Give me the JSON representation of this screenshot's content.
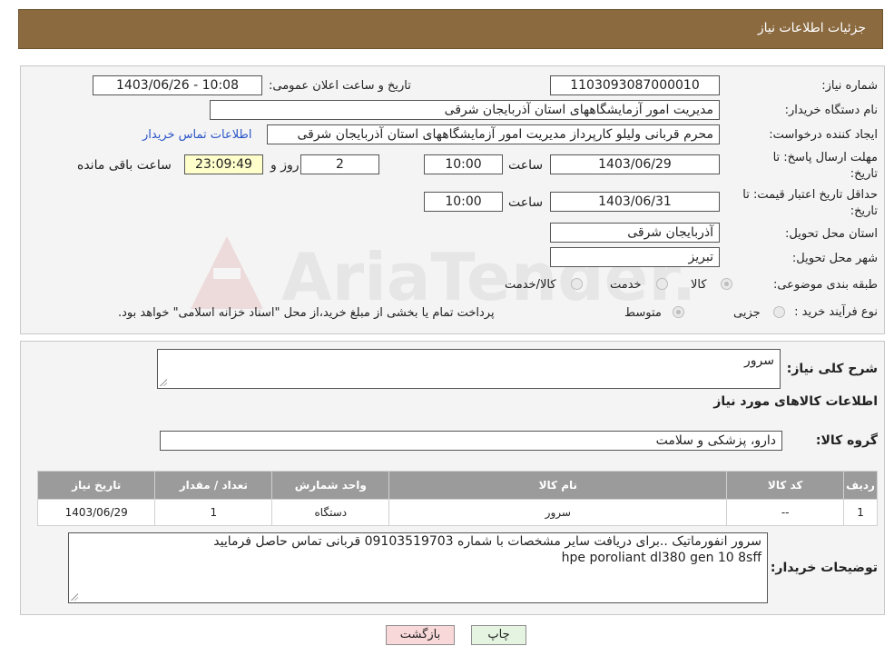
{
  "header": {
    "title": "جزئیات اطلاعات نیاز"
  },
  "watermark": {
    "text": "AriaTender.neT"
  },
  "form": {
    "need_number_label": "شماره نیاز:",
    "need_number": "1103093087000010",
    "announce_label": "تاریخ و ساعت اعلان عمومی:",
    "announce_value": "1403/06/26 - 10:08",
    "buyer_org_label": "نام دستگاه خریدار:",
    "buyer_org": "مدیریت امور آزمایشگاههای استان آذربایجان شرقی",
    "requester_label": "ایجاد کننده درخواست:",
    "requester": "محرم قربانی ولیلو کارپرداز مدیریت امور آزمایشگاههای استان آذربایجان شرقی",
    "contact_link": "اطلاعات تماس خریدار",
    "deadline_label_1": "مهلت ارسال پاسخ: تا",
    "deadline_label_2": "تاریخ:",
    "deadline_date": "1403/06/29",
    "time_label": "ساعت",
    "deadline_time": "10:00",
    "days_value": "2",
    "days_label": "روز و",
    "remaining_time": "23:09:49",
    "remaining_label": "ساعت باقی مانده",
    "validity_label_1": "حداقل تاریخ اعتبار قیمت: تا",
    "validity_label_2": "تاریخ:",
    "validity_date": "1403/06/31",
    "validity_time": "10:00",
    "province_label": "استان محل تحویل:",
    "province": "آذربایجان شرقی",
    "city_label": "شهر محل تحویل:",
    "city": "تبریز",
    "category_label": "طبقه بندی موضوعی:",
    "category_options": [
      "کالا",
      "خدمت",
      "کالا/خدمت"
    ],
    "process_label": "نوع فرآیند خرید :",
    "process_options": [
      "جزیی",
      "متوسط"
    ],
    "process_note": "پرداخت تمام یا بخشی از مبلغ خرید،از محل \"اسناد خزانه اسلامی\" خواهد بود."
  },
  "details": {
    "summary_label": "شرح کلی نیاز:",
    "summary_value": "سرور",
    "goods_info_title": "اطلاعات کالاهای مورد نیاز",
    "group_label": "گروه کالا:",
    "group_value": "دارو، پزشکی و سلامت",
    "table": {
      "headers": [
        "ردیف",
        "کد کالا",
        "نام کالا",
        "واحد شمارش",
        "تعداد / مقدار",
        "تاریخ نیاز"
      ],
      "rows": [
        [
          "1",
          "--",
          "سرور",
          "دستگاه",
          "1",
          "1403/06/29"
        ]
      ]
    },
    "buyer_notes_label": "توضیحات خریدار:",
    "buyer_notes_line1": "سرور انفورماتیک ..برای دریافت سایر مشخصات با شماره 09103519703  قربانی تماس حاصل فرمایید",
    "buyer_notes_line2": "hpe poroliant dl380 gen 10 8sff"
  },
  "buttons": {
    "print": "چاپ",
    "back": "بازگشت"
  },
  "colors": {
    "header_bg": "#8b6a40",
    "link": "#2a55c8",
    "back_btn": "#f8d8d8",
    "print_btn": "#e4f4e0"
  }
}
